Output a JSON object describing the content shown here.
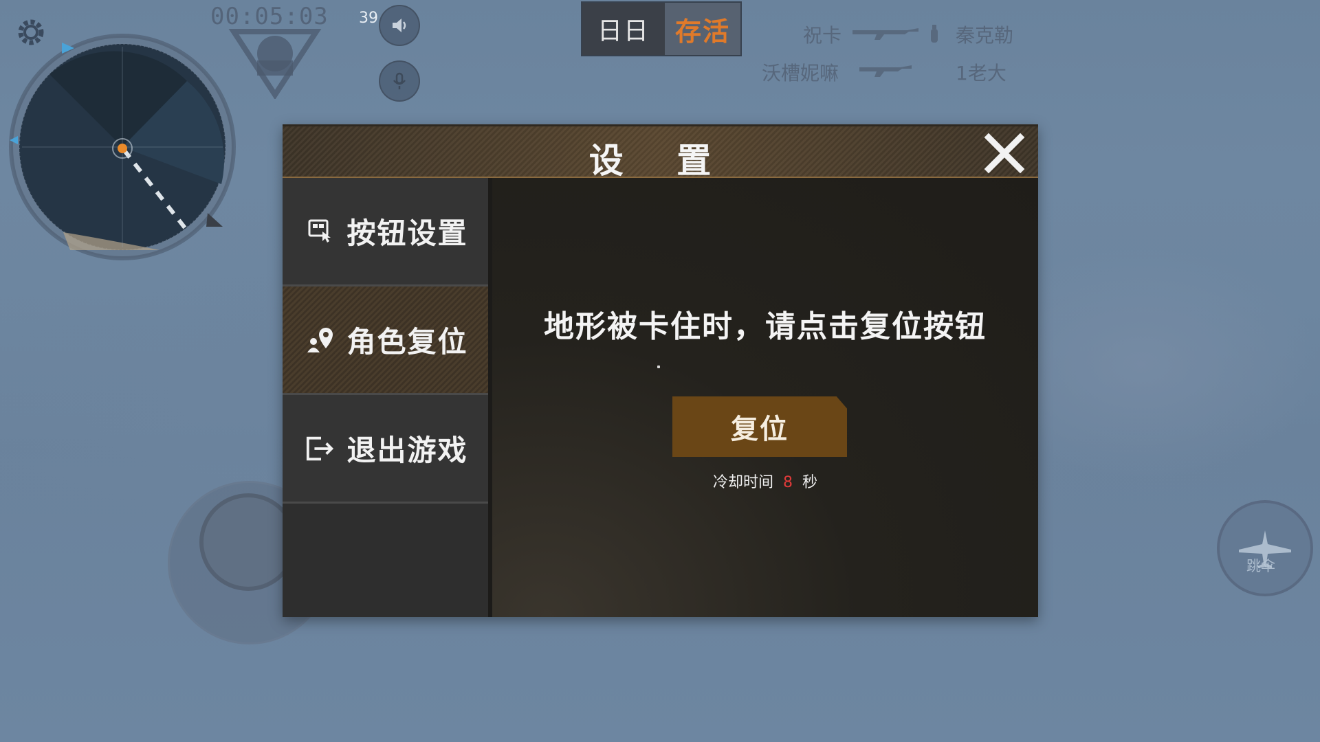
{
  "hud": {
    "timer": "00:05:03",
    "ping": "39",
    "mode_left": "日日",
    "mode_right": "存活",
    "killfeed": [
      {
        "killer": "祝卡",
        "victim": "秦克勒"
      },
      {
        "killer": "沃槽妮嘛",
        "victim": "1老大"
      }
    ],
    "parachute_label": "跳伞"
  },
  "dialog": {
    "title": "设 置",
    "sidebar": [
      {
        "label": "按钮设置",
        "icon": "button-settings-icon"
      },
      {
        "label": "角色复位",
        "icon": "location-reset-icon",
        "active": true
      },
      {
        "label": "退出游戏",
        "icon": "exit-icon"
      }
    ],
    "message": "地形被卡住时，请点击复位按钮",
    "reset_button": "复位",
    "cooldown_prefix": "冷却时间",
    "cooldown_value": "8",
    "cooldown_suffix": "秒"
  },
  "colors": {
    "accent_orange": "#e07a2a",
    "reset_button_bg": "#6a4616",
    "cooldown_number": "#e03a3a"
  }
}
